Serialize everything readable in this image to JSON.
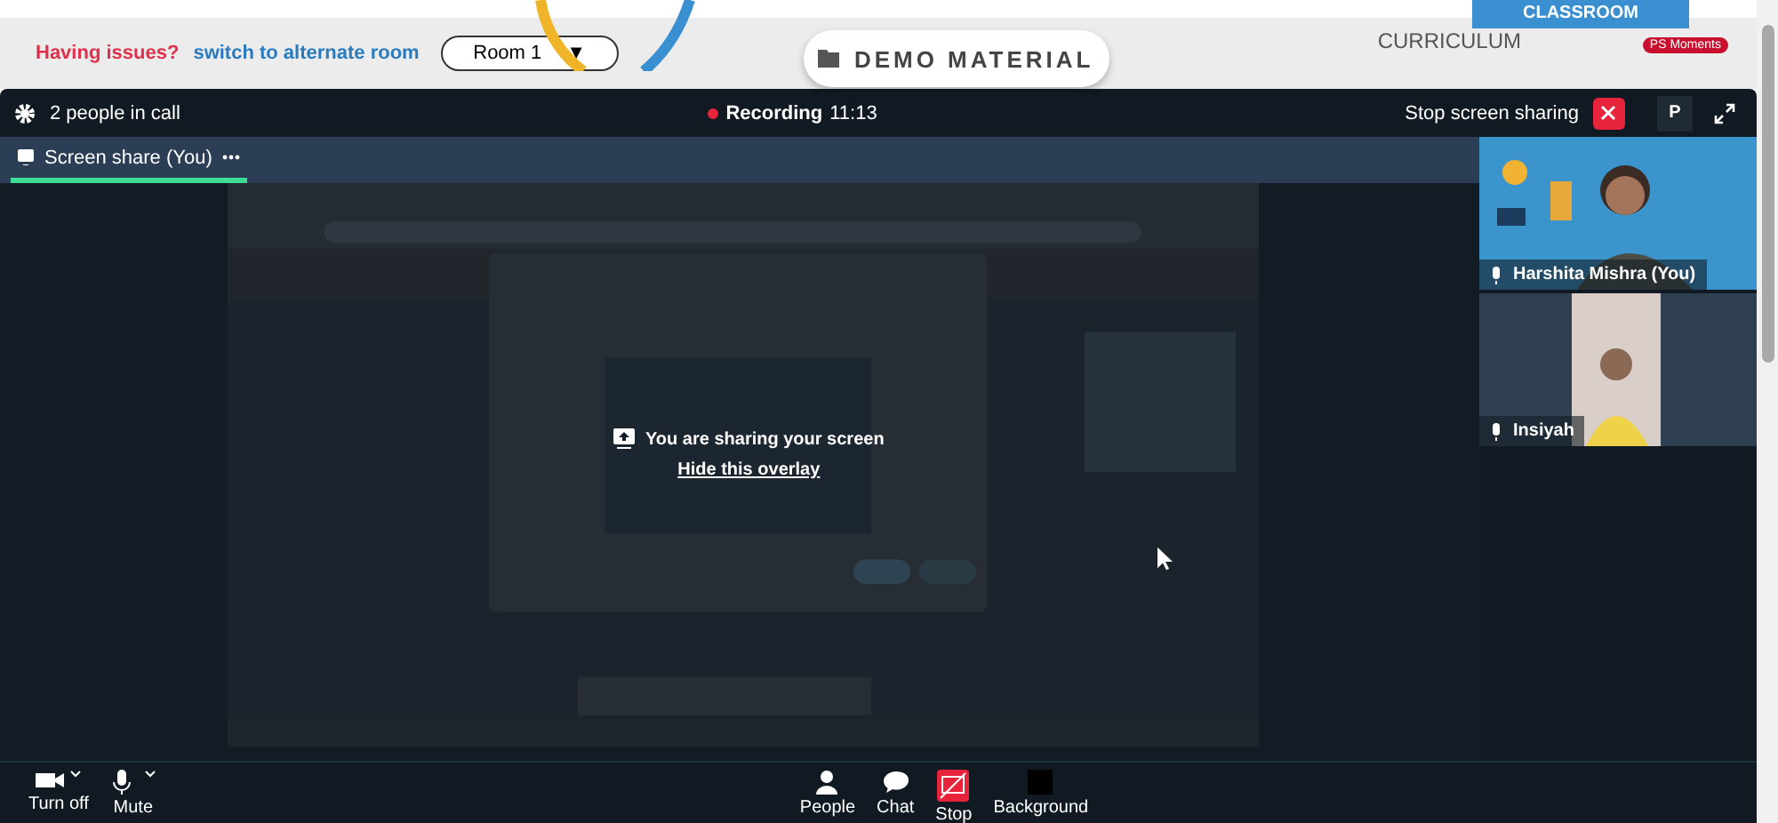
{
  "header": {
    "issues_label": "Having issues?",
    "switch_link": "switch to alternate room",
    "room_select": "Room 1",
    "room_caret": "▼",
    "demo_button": "DEMO MATERIAL",
    "curriculum": "CURRICULUM",
    "classroom_tab": "CLASSROOM",
    "moments_badge": "PS Moments"
  },
  "call_bar": {
    "people": "2 people in call",
    "recording_label": "Recording",
    "recording_time": "11:13",
    "stop_sharing": "Stop screen sharing",
    "user_initial": "P"
  },
  "tabs": [
    {
      "label": "Screen share (You)",
      "selected": true
    }
  ],
  "overlay": {
    "title": "You are sharing your screen",
    "link": "Hide this overlay"
  },
  "participants": [
    {
      "name": "Harshita Mishra (You)",
      "kind": "adult"
    },
    {
      "name": "Insiyah",
      "kind": "child"
    }
  ],
  "toolbar_left": [
    {
      "label": "Turn off",
      "kind": "camera"
    },
    {
      "label": "Mute",
      "kind": "mic"
    }
  ],
  "toolbar_center": [
    {
      "label": "People",
      "kind": "people"
    },
    {
      "label": "Chat",
      "kind": "chat"
    },
    {
      "label": "Stop",
      "kind": "stop"
    },
    {
      "label": "Background",
      "kind": "background"
    }
  ]
}
